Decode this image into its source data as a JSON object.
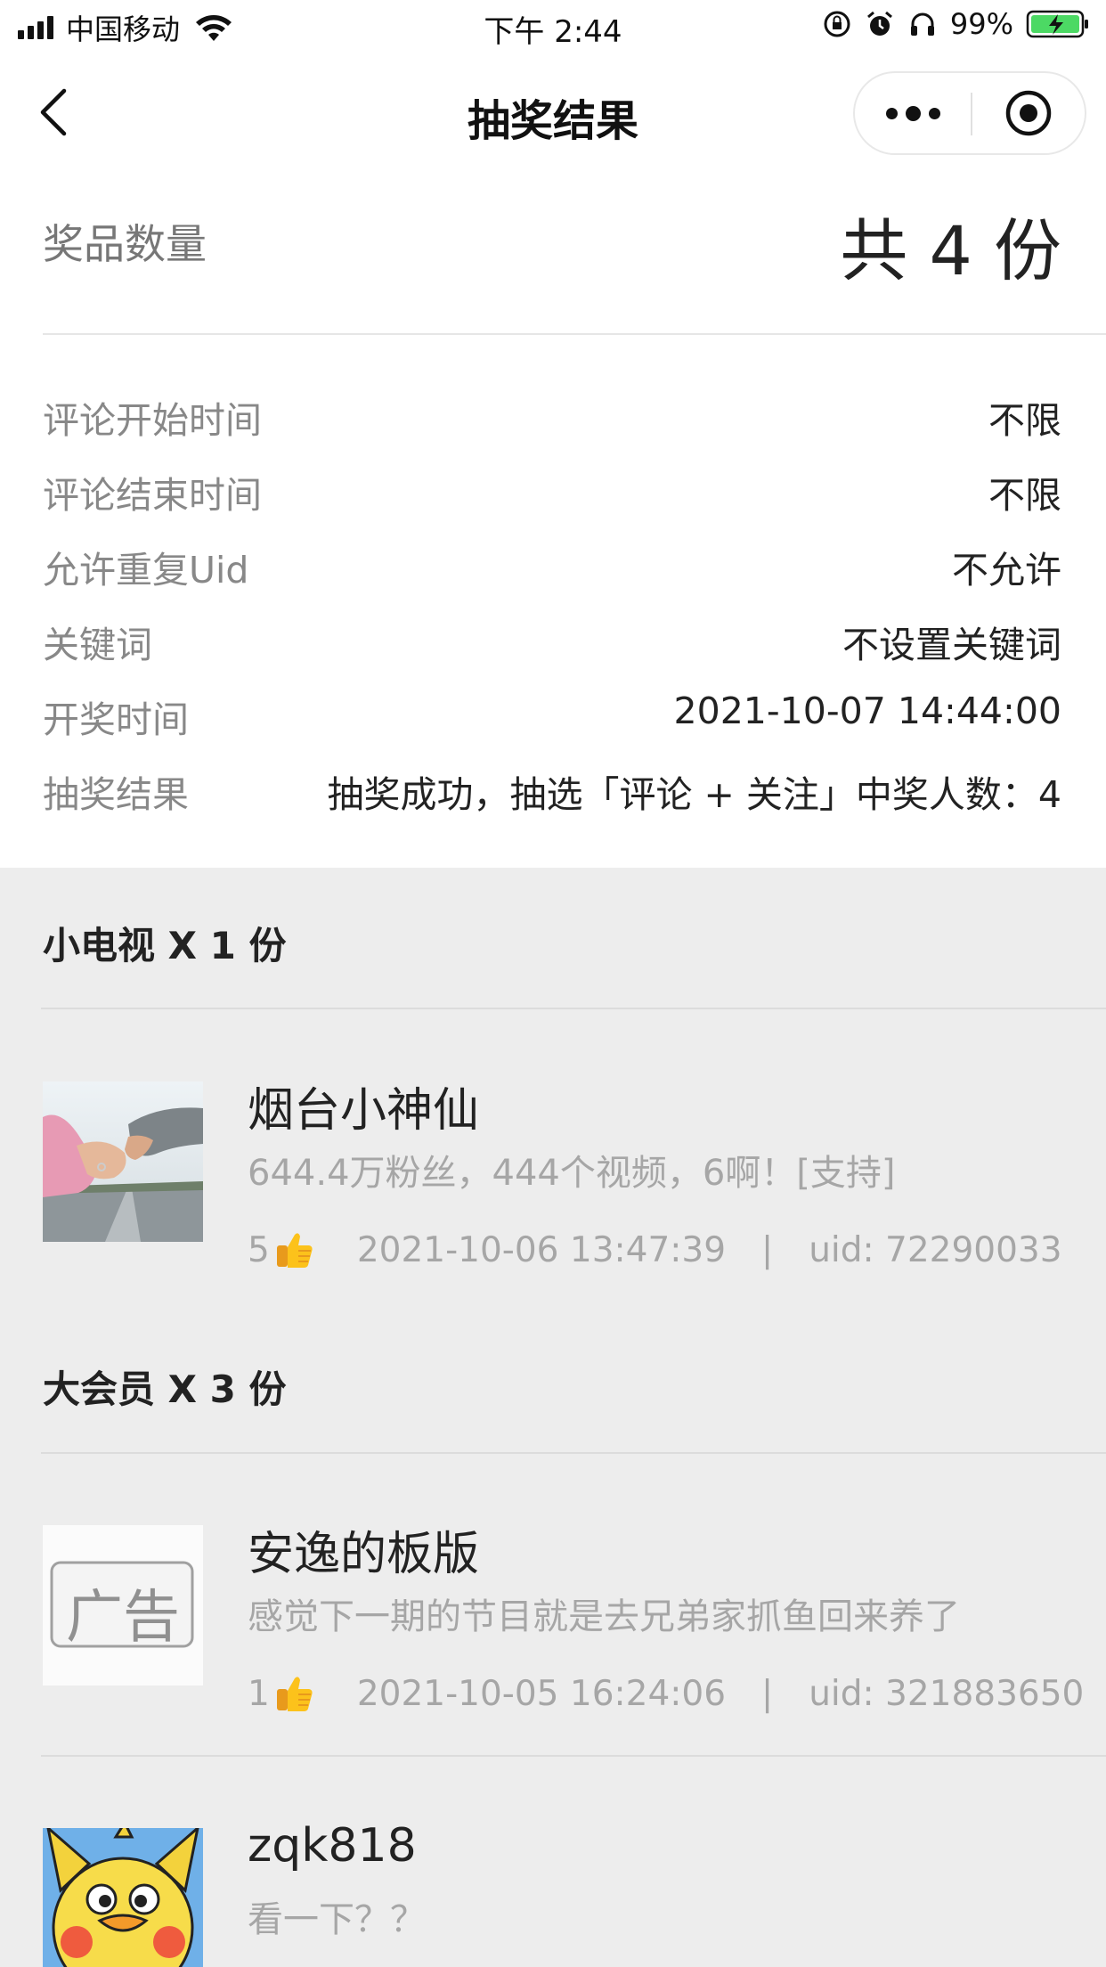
{
  "status_bar": {
    "carrier": "中国移动",
    "time": "下午 2:44",
    "battery": "99%"
  },
  "nav": {
    "title": "抽奖结果"
  },
  "prize_count": {
    "label": "奖品数量",
    "value": "共 4 份"
  },
  "info": [
    {
      "label": "评论开始时间",
      "value": "不限"
    },
    {
      "label": "评论结束时间",
      "value": "不限"
    },
    {
      "label": "允许重复Uid",
      "value": "不允许"
    },
    {
      "label": "关键词",
      "value": "不设置关键词"
    },
    {
      "label": "开奖时间",
      "value": "2021-10-07 14:44:00"
    },
    {
      "label": "抽奖结果",
      "value": "抽奖成功，抽选「评论 + 关注」中奖人数：4"
    }
  ],
  "groups": [
    {
      "title": "小电视 X 1 份",
      "winners": [
        {
          "name": "烟台小神仙",
          "comment": "644.4万粉丝，444个视频，6啊！[支持]",
          "likes": "5",
          "time": "2021-10-06 13:47:39",
          "separator": "|",
          "uid": "uid: 72290033",
          "avatar_icon": "photo-hands-avatar"
        }
      ]
    },
    {
      "title": "大会员 X 3 份",
      "winners": [
        {
          "name": "安逸的板版",
          "comment": "感觉下一期的节目就是去兄弟家抓鱼回来养了",
          "likes": "1",
          "time": "2021-10-05 16:24:06",
          "separator": "|",
          "uid": "uid: 321883650",
          "avatar_icon": "ad-badge-avatar",
          "avatar_text": "广告"
        },
        {
          "name": "zqk818",
          "comment": "看一下？？",
          "avatar_icon": "cartoon-duck-avatar"
        }
      ]
    }
  ]
}
